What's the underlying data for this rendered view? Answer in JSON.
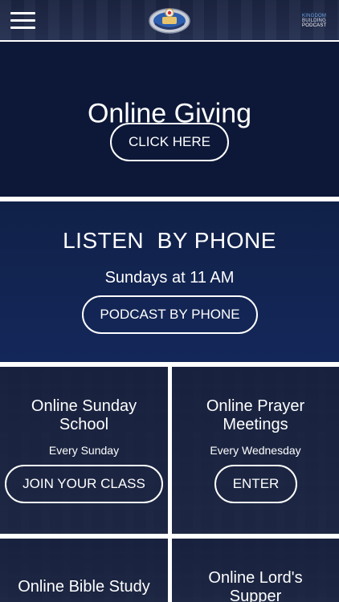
{
  "header": {
    "podcast_logo": {
      "line1": "KINGDOM",
      "line2": "BUILDING",
      "line3": "PODCAST"
    },
    "colors": {
      "bar": "#1b2440"
    }
  },
  "giving": {
    "title": "Online Giving",
    "button_label": "CLICK HERE",
    "background": "#0d1838"
  },
  "phone": {
    "title": "LISTEN  BY PHONE",
    "subtitle": "Sundays at 11 AM",
    "button_label": "PODCAST BY PHONE",
    "background": "#102148"
  },
  "tiles": [
    {
      "title": "Online Sunday\nSchool",
      "subtitle": "Every Sunday",
      "button_label": "JOIN YOUR CLASS"
    },
    {
      "title": "Online Prayer\nMeetings",
      "subtitle": "Every Wednesday",
      "button_label": "ENTER"
    },
    {
      "title": "Online Bible Study"
    },
    {
      "title": "Online Lord's\nSupper"
    }
  ],
  "icons": {
    "menu": "hamburger-menu-icon",
    "church_logo": "church-seal-logo",
    "podcast_logo": "kingdom-building-podcast-logo"
  }
}
